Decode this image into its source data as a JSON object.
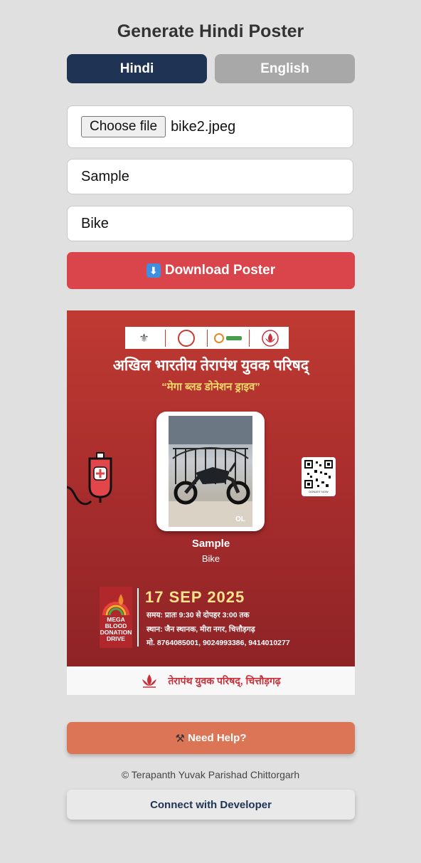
{
  "page": {
    "title": "Generate Hindi Poster"
  },
  "tabs": [
    {
      "label": "Hindi",
      "active": true
    },
    {
      "label": "English",
      "active": false
    }
  ],
  "form": {
    "file_button": "Choose file",
    "file_name": "bike2.jpeg",
    "name_value": "Sample",
    "role_value": "Bike",
    "download_label": "Download Poster",
    "download_icon": "down-arrow-icon"
  },
  "poster": {
    "org_title": "अखिल भारतीय तेरापंथ युवक परिषद्",
    "subtitle": "“मेगा ब्लड डोनेशन ड्राइव”",
    "name": "Sample",
    "role": "Bike",
    "qr_caption": "DONATE NOW",
    "mega_text": "MEGA BLOOD DONATION DRIVE",
    "date": "17 SEP 2025",
    "time_line": "समय: प्रातः 9:30 से दोपहर 3:00 तक",
    "venue_line": "स्थान: जैन स्थानक, मीरा नगर, चित्तौड़गढ़",
    "phone_line": "मो. 8764085001, 9024993386, 9414010277",
    "footer": "तेरापंथ युवक परिषद्, चित्तौड़गढ़",
    "colors": {
      "primary": "#a82d2d",
      "accent": "#ffe28c"
    }
  },
  "help": {
    "label": "Need Help?",
    "icon": "tools-icon"
  },
  "footer": {
    "copyright": "© Terapanth Yuvak Parishad Chittorgarh",
    "connect_label": "Connect with Developer"
  },
  "colors": {
    "tab_active": "#1f3354",
    "tab_inactive": "#a8a8a8",
    "download": "#d9454a",
    "help": "#db7556"
  }
}
